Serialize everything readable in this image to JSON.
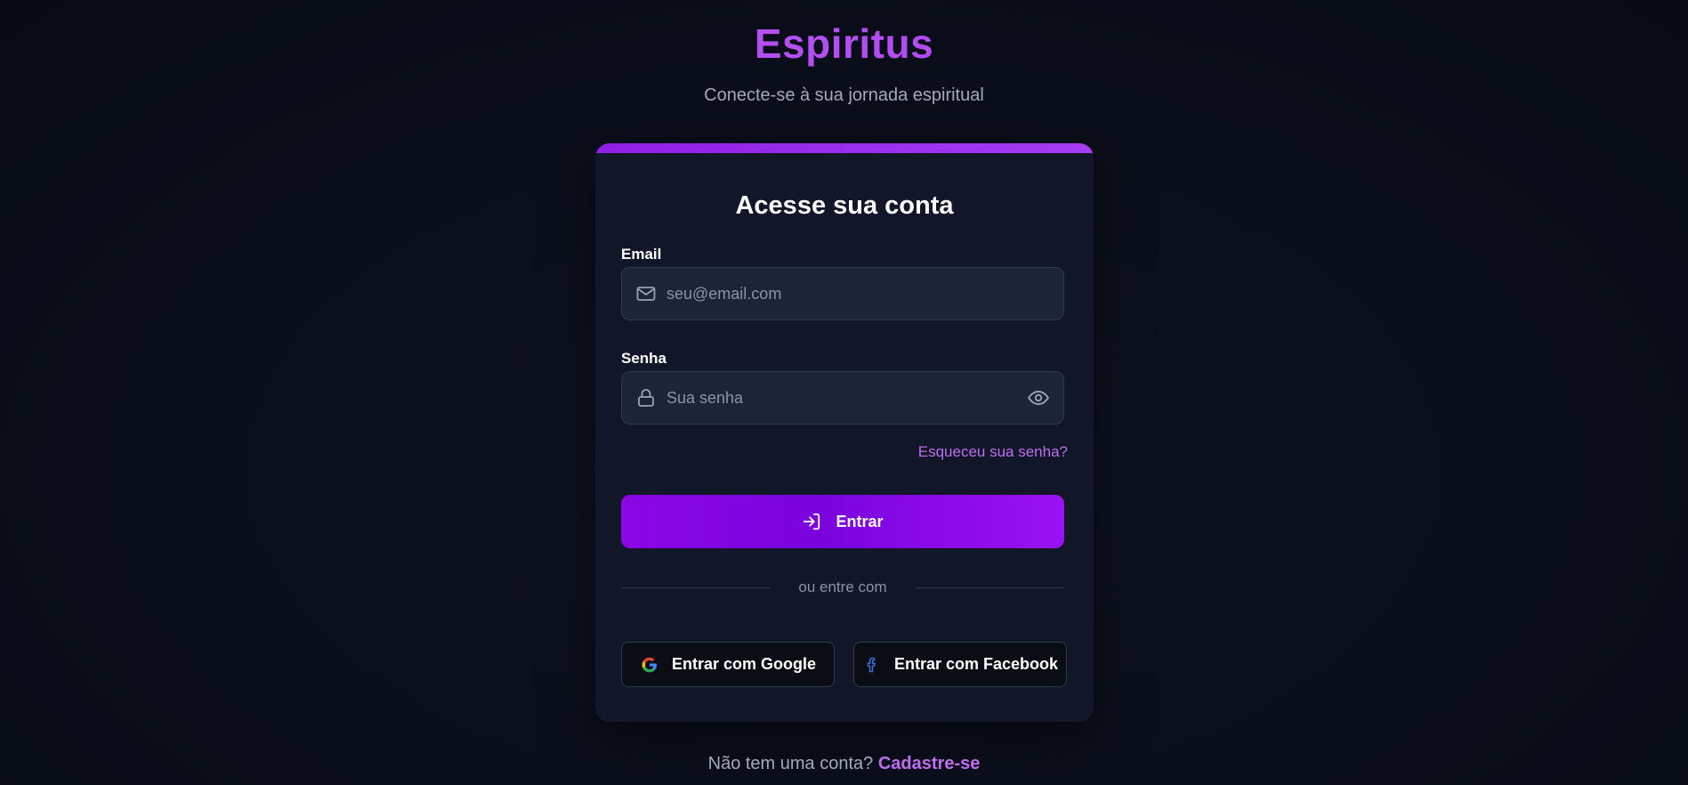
{
  "header": {
    "brand": "Espiritus",
    "tagline": "Conecte-se à sua jornada espiritual"
  },
  "login_card": {
    "title": "Acesse sua conta",
    "email": {
      "label": "Email",
      "placeholder": "seu@email.com",
      "value": "",
      "icon": "mail-icon"
    },
    "password": {
      "label": "Senha",
      "placeholder": "Sua senha",
      "value": "",
      "icon": "lock-icon",
      "toggle_icon": "eye-icon"
    },
    "forgot_password": "Esqueceu sua senha?",
    "submit": {
      "label": "Entrar",
      "icon": "log-in-icon"
    },
    "divider_text": "ou entre com",
    "social": {
      "google_label": "Entrar com Google",
      "facebook_label": "Entrar com Facebook"
    }
  },
  "footer": {
    "prompt": "Não tem uma conta?",
    "signup_link": "Cadastre-se"
  },
  "colors": {
    "accent": "#9d1cf0",
    "link": "#c06ef0",
    "background": "#0b0f1c",
    "card": "#111728",
    "input": "#1c2536"
  }
}
